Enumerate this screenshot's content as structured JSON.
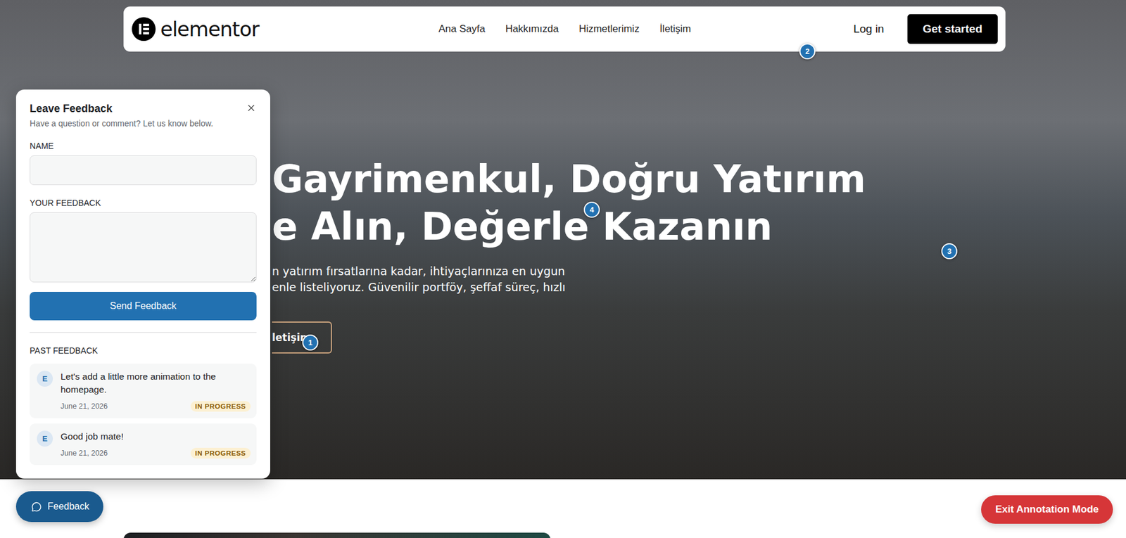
{
  "navbar": {
    "logo": "elementor",
    "links": [
      {
        "label": "Ana Sayfa"
      },
      {
        "label": "Hakkımızda"
      },
      {
        "label": "Hizmetlerimiz"
      },
      {
        "label": "İletişim"
      }
    ],
    "login": "Log in",
    "cta": "Get started"
  },
  "hero": {
    "title_lines": [
      "Gayrimenkul, Doğru Yatırım",
      "e Alın, Değerle Kazanın"
    ],
    "paragraph_lines": [
      "n yatırım fırsatlarına kadar, ihtiyaçlarınıza en uygun",
      "enle listeliyoruz. Güvenilir portföy, şeffaf süreç, hızlı"
    ],
    "button": "letişim"
  },
  "annotations": [
    {
      "number": "1"
    },
    {
      "number": "2"
    },
    {
      "number": "3"
    },
    {
      "number": "4"
    }
  ],
  "feedback_panel": {
    "title": "Leave Feedback",
    "subtitle": "Have a question or comment? Let us know below.",
    "fields": [
      {
        "label": "NAME",
        "kind": "input",
        "value": ""
      },
      {
        "label": "YOUR FEEDBACK",
        "kind": "textarea",
        "value": ""
      }
    ],
    "submit": "Send Feedback",
    "past_title": "PAST FEEDBACK",
    "items": [
      {
        "avatar": "E",
        "text": "Let's add a little more animation to the homepage.",
        "date": "June 21, 2026",
        "status": "IN PROGRESS"
      },
      {
        "avatar": "E",
        "text": "Good job mate!",
        "date": "June 21, 2026",
        "status": "IN PROGRESS"
      }
    ]
  },
  "feedback_button": "Feedback",
  "exit_button": "Exit Annotation Mode"
}
